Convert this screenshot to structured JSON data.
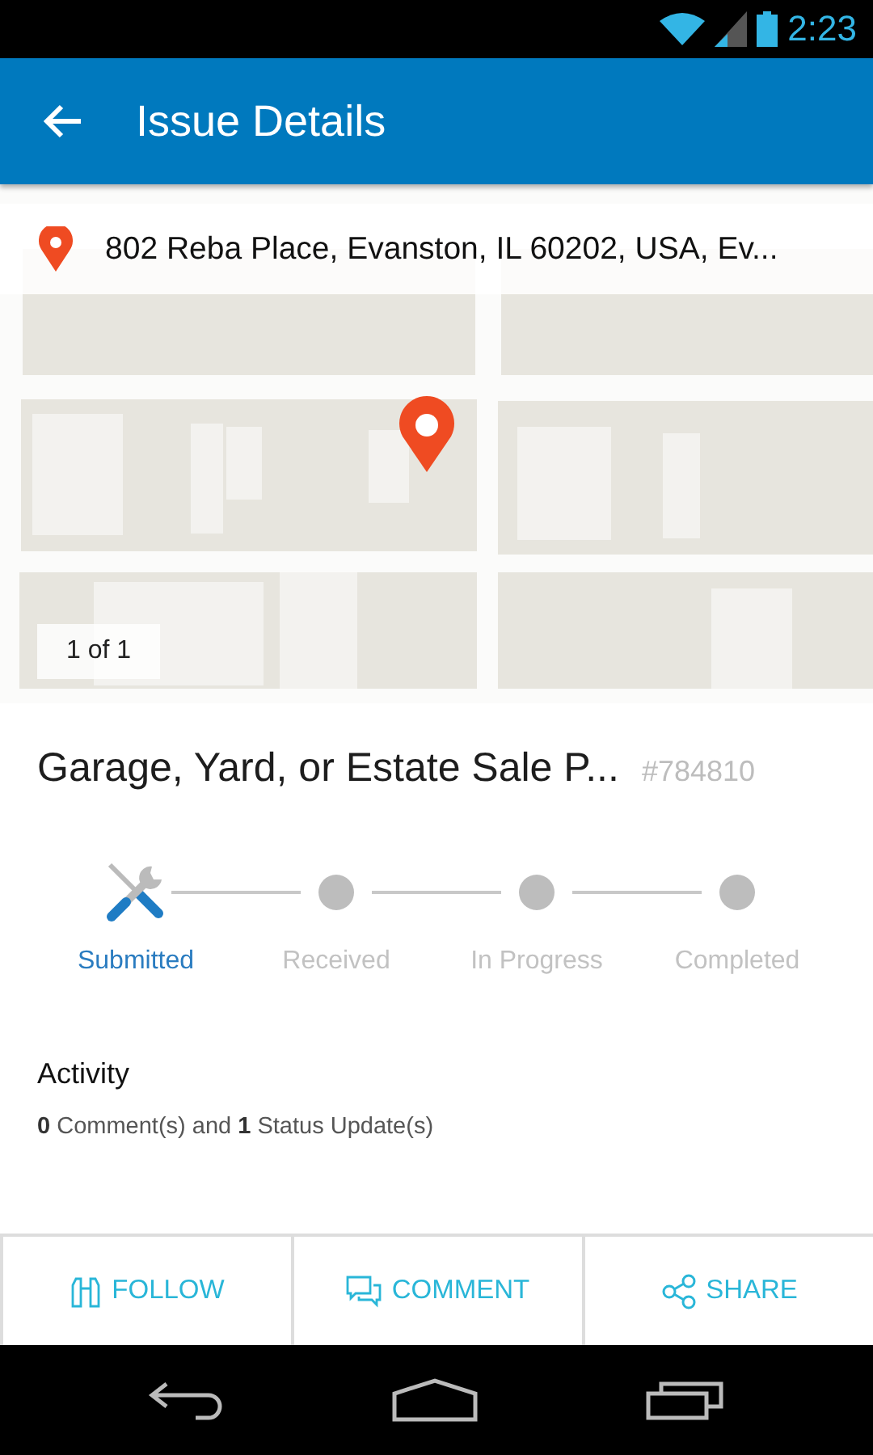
{
  "status_bar": {
    "time": "2:23"
  },
  "app_bar": {
    "title": "Issue Details"
  },
  "map": {
    "kind": "picture",
    "address": "802 Reba Place, Evanston, IL 60202, USA, Ev...",
    "photo_counter": "1 of 1"
  },
  "issue": {
    "title": "Garage, Yard, or Estate Sale P...",
    "number": "#784810"
  },
  "steps": [
    {
      "label": "Submitted",
      "active": true
    },
    {
      "label": "Received",
      "active": false
    },
    {
      "label": "In Progress",
      "active": false
    },
    {
      "label": "Completed",
      "active": false
    }
  ],
  "activity": {
    "heading": "Activity",
    "summary": "**0** Comment(s) and **1** Status Update(s)"
  },
  "actions": [
    {
      "kind": "follow",
      "label": "FOLLOW"
    },
    {
      "kind": "comment",
      "label": "COMMENT"
    },
    {
      "kind": "share",
      "label": "SHARE"
    }
  ]
}
